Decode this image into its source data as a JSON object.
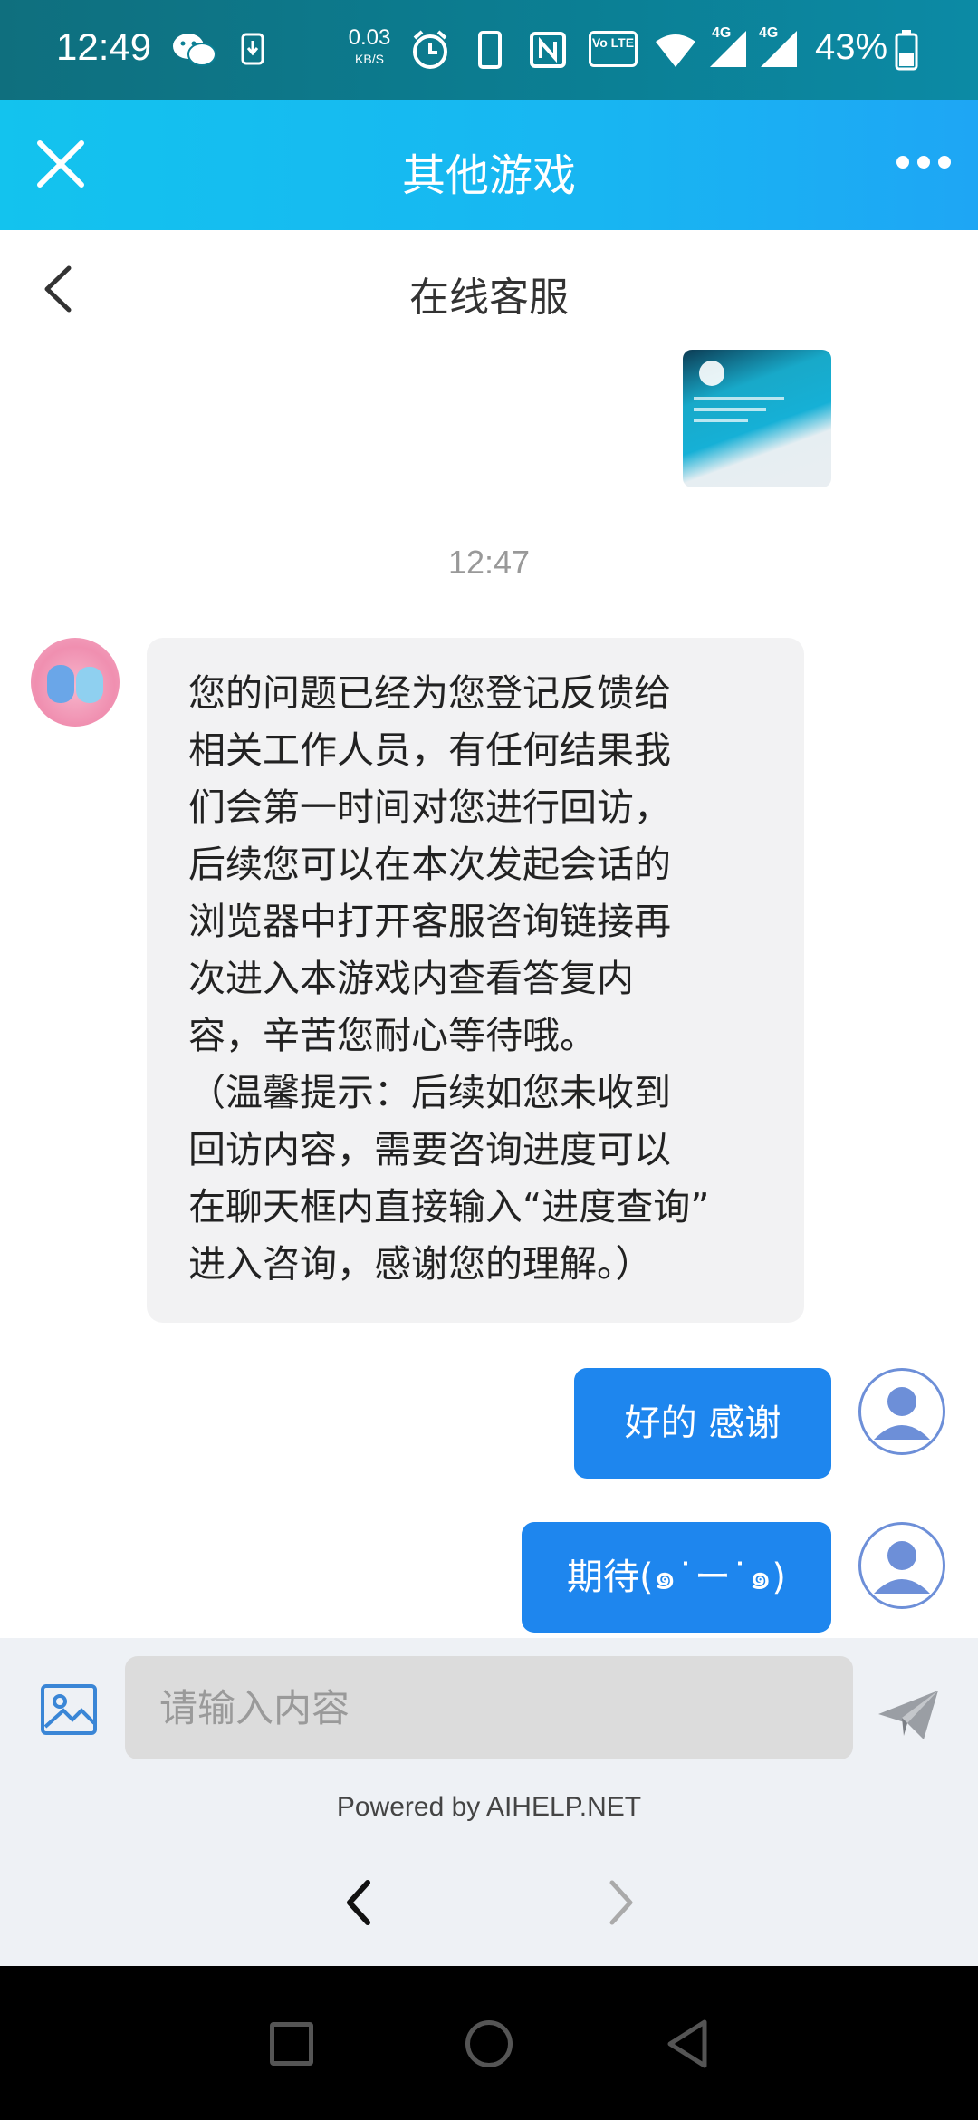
{
  "status_bar": {
    "time": "12:49",
    "speed_value": "0.03",
    "speed_unit": "KB/S",
    "signal_label_1": "4G",
    "signal_label_2": "4G",
    "volte_label": "Vo LTE",
    "battery_percent": "43%"
  },
  "app_header": {
    "title": "其他游戏",
    "close_icon": "close-icon",
    "more_icon": "more-dots-icon"
  },
  "sub_header": {
    "title": "在线客服",
    "back_icon": "back-chevron-icon"
  },
  "chat": {
    "timestamp": "12:47",
    "agent_message": "您的问题已经为您登记反馈给\n相关工作人员，有任何结果我\n们会第一时间对您进行回访，\n后续您可以在本次发起会话的\n浏览器中打开客服咨询链接再\n次进入本游戏内查看答复内\n容，辛苦您耐心等待哦。\n（温馨提示：后续如您未收到\n回访内容，需要咨询进度可以\n在聊天框内直接输入“进度查询”\n进入咨询，感谢您的理解。）",
    "user_messages": [
      "好的 感谢",
      "期待(๑˙ー˙๑)"
    ]
  },
  "input": {
    "placeholder": "请输入内容",
    "value": "",
    "image_icon": "image-icon",
    "send_icon": "send-icon"
  },
  "footer": {
    "powered_by": "Powered by AIHELP.NET"
  },
  "colors": {
    "header_gradient_start": "#13c3ee",
    "header_gradient_end": "#1ea6f4",
    "user_bubble": "#1e86ee",
    "agent_bubble": "#f2f2f3",
    "status_bar": "#0b7f94"
  }
}
